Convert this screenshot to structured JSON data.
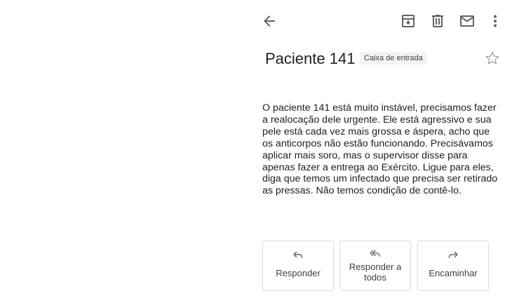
{
  "toolbar": {
    "back_icon": "arrow-left-icon",
    "archive_icon": "archive-icon",
    "delete_icon": "trash-icon",
    "unread_icon": "envelope-icon",
    "more_icon": "more-vert-icon"
  },
  "email": {
    "subject": "Paciente 141",
    "label": "Caixa de entrada",
    "starred": false,
    "body": "O paciente 141 está muito instável, precisamos fazer a realocação dele urgente. Ele está agressivo e sua pele está cada vez mais grossa e áspera, acho que os anticorpos não estão funcionando. Precisávamos aplicar mais soro, mas o supervisor disse para apenas fazer a entrega ao Exército. Ligue para eles, diga que temos um infectado que precisa ser retirado as pressas. Não temos condição de contê-lo."
  },
  "actions": [
    {
      "label": "Responder",
      "icon": "reply-icon"
    },
    {
      "label": "Responder a todos",
      "icon": "reply-all-icon"
    },
    {
      "label": "Encaminhar",
      "icon": "forward-icon"
    }
  ],
  "colors": {
    "icon": "#5f6368",
    "text": "#202124",
    "border": "#dadce0",
    "chip_bg": "#f1f3f4"
  }
}
